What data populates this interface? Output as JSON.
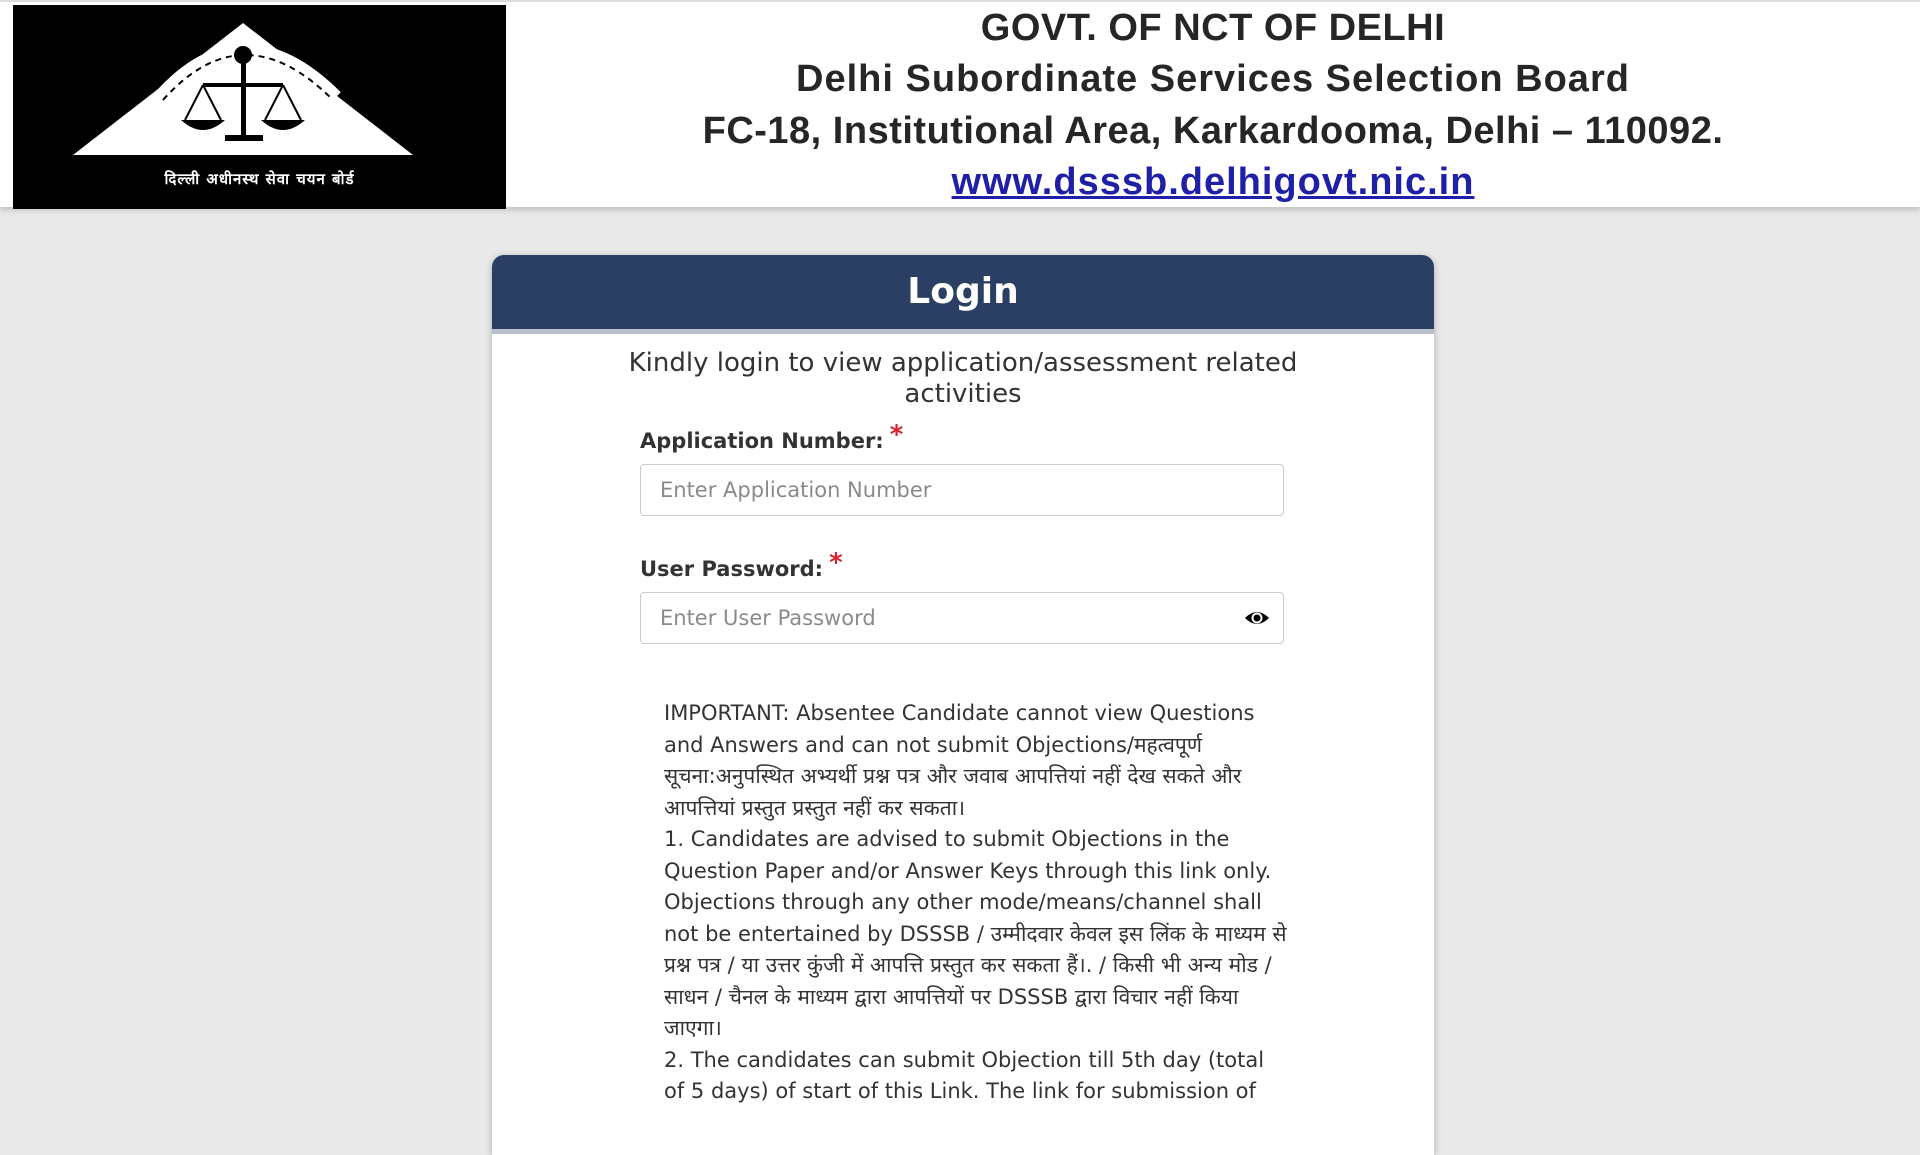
{
  "header": {
    "logo_caption": "दिल्ली अधीनस्थ सेवा चयन बोर्ड",
    "line1": "GOVT. OF NCT OF DELHI",
    "line2": "Delhi Subordinate Services Selection Board",
    "line3": "FC-18, Institutional Area, Karkardooma, Delhi – 110092.",
    "website": "www.dsssb.delhigovt.nic.in"
  },
  "login": {
    "title": "Login",
    "intro": "Kindly login to view application/assessment related activities",
    "application_number": {
      "label": "Application Number:",
      "required_mark": "*",
      "placeholder": "Enter Application Number",
      "value": ""
    },
    "password": {
      "label": "User Password:",
      "required_mark": "*",
      "placeholder": "Enter User Password",
      "value": "",
      "toggle_icon": "eye-icon"
    }
  },
  "notice": {
    "important": "IMPORTANT: Absentee Candidate cannot view Questions and Answers and can not submit Objections/महत्वपूर्ण सूचना:अनुपस्थित अभ्यर्थी प्रश्न पत्र और जवाब आपत्तियां नहीं देख सकते और आपत्तियां प्रस्तुत प्रस्तुत नहीं कर सकता।",
    "point1": "1. Candidates are advised to submit Objections in the Question Paper and/or Answer Keys through this link only. Objections through any other mode/means/channel shall not be entertained by DSSSB / उम्मीदवार केवल इस लिंक के माध्यम से प्रश्न पत्र / या उत्तर कुंजी में आपत्ति प्रस्तुत कर सकता हैं।. / किसी भी अन्य मोड / साधन / चैनल के माध्यम द्वारा आपत्तियों पर DSSSB द्वारा विचार नहीं किया जाएगा।",
    "point2": "2. The candidates can submit Objection till 5th day (total of 5 days) of start of this Link. The link for submission of"
  },
  "colors": {
    "card_header": "#2a3f63",
    "required": "#d9232d",
    "link": "#1f1fa8",
    "page_bg": "#e9e9e9"
  }
}
